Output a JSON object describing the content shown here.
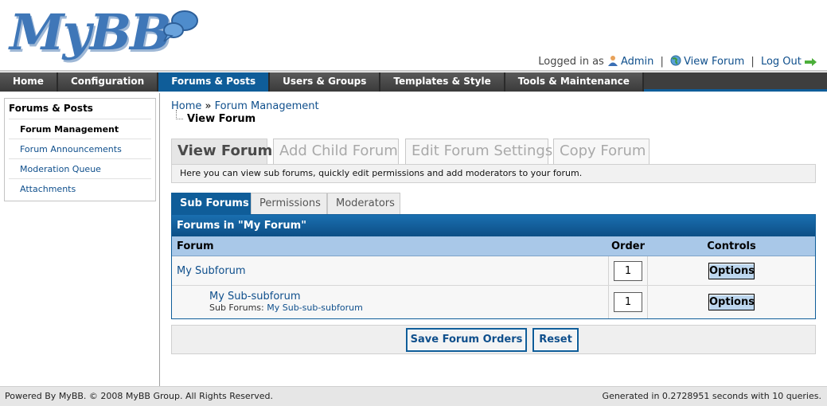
{
  "logo": {
    "text": "MyBB"
  },
  "userbar": {
    "logged_in_as": "Logged in as",
    "username": "Admin",
    "view_forum": "View Forum",
    "log_out": "Log Out",
    "separator": "|"
  },
  "nav": {
    "tabs": [
      {
        "label": "Home"
      },
      {
        "label": "Configuration"
      },
      {
        "label": "Forums & Posts"
      },
      {
        "label": "Users & Groups"
      },
      {
        "label": "Templates & Style"
      },
      {
        "label": "Tools & Maintenance"
      }
    ],
    "active_index": 2
  },
  "sidebar": {
    "title": "Forums & Posts",
    "items": [
      {
        "label": "Forum Management"
      },
      {
        "label": "Forum Announcements"
      },
      {
        "label": "Moderation Queue"
      },
      {
        "label": "Attachments"
      }
    ]
  },
  "breadcrumb": {
    "home": "Home",
    "separator": "»",
    "current": "Forum Management",
    "sub": "View Forum"
  },
  "tabs": [
    {
      "label": "View Forum"
    },
    {
      "label": "Add Child Forum"
    },
    {
      "label": "Edit Forum Settings"
    },
    {
      "label": "Copy Forum"
    }
  ],
  "description": "Here you can view sub forums, quickly edit permissions and add moderators to your forum.",
  "subtabs": [
    {
      "label": "Sub Forums"
    },
    {
      "label": "Permissions"
    },
    {
      "label": "Moderators"
    }
  ],
  "table": {
    "title": "Forums in \"My Forum\"",
    "columns": {
      "forum": "Forum",
      "order": "Order",
      "controls": "Controls"
    },
    "rows": [
      {
        "name": "My Subforum",
        "order": "1",
        "options": "Options"
      },
      {
        "name": "My Sub-subforum",
        "subforums_label": "Sub Forums:",
        "subforum_link": "My Sub-sub-subforum",
        "order": "1",
        "options": "Options"
      }
    ]
  },
  "buttons": {
    "save": "Save Forum Orders",
    "reset": "Reset"
  },
  "footer": {
    "left": "Powered By MyBB. © 2008 MyBB Group. All Rights Reserved.",
    "right": "Generated in 0.2728951 seconds with 10 queries."
  },
  "colors": {
    "accent": "#0f5d99",
    "link": "#0f4f8c",
    "nav_bg": "#3e3e3e"
  }
}
